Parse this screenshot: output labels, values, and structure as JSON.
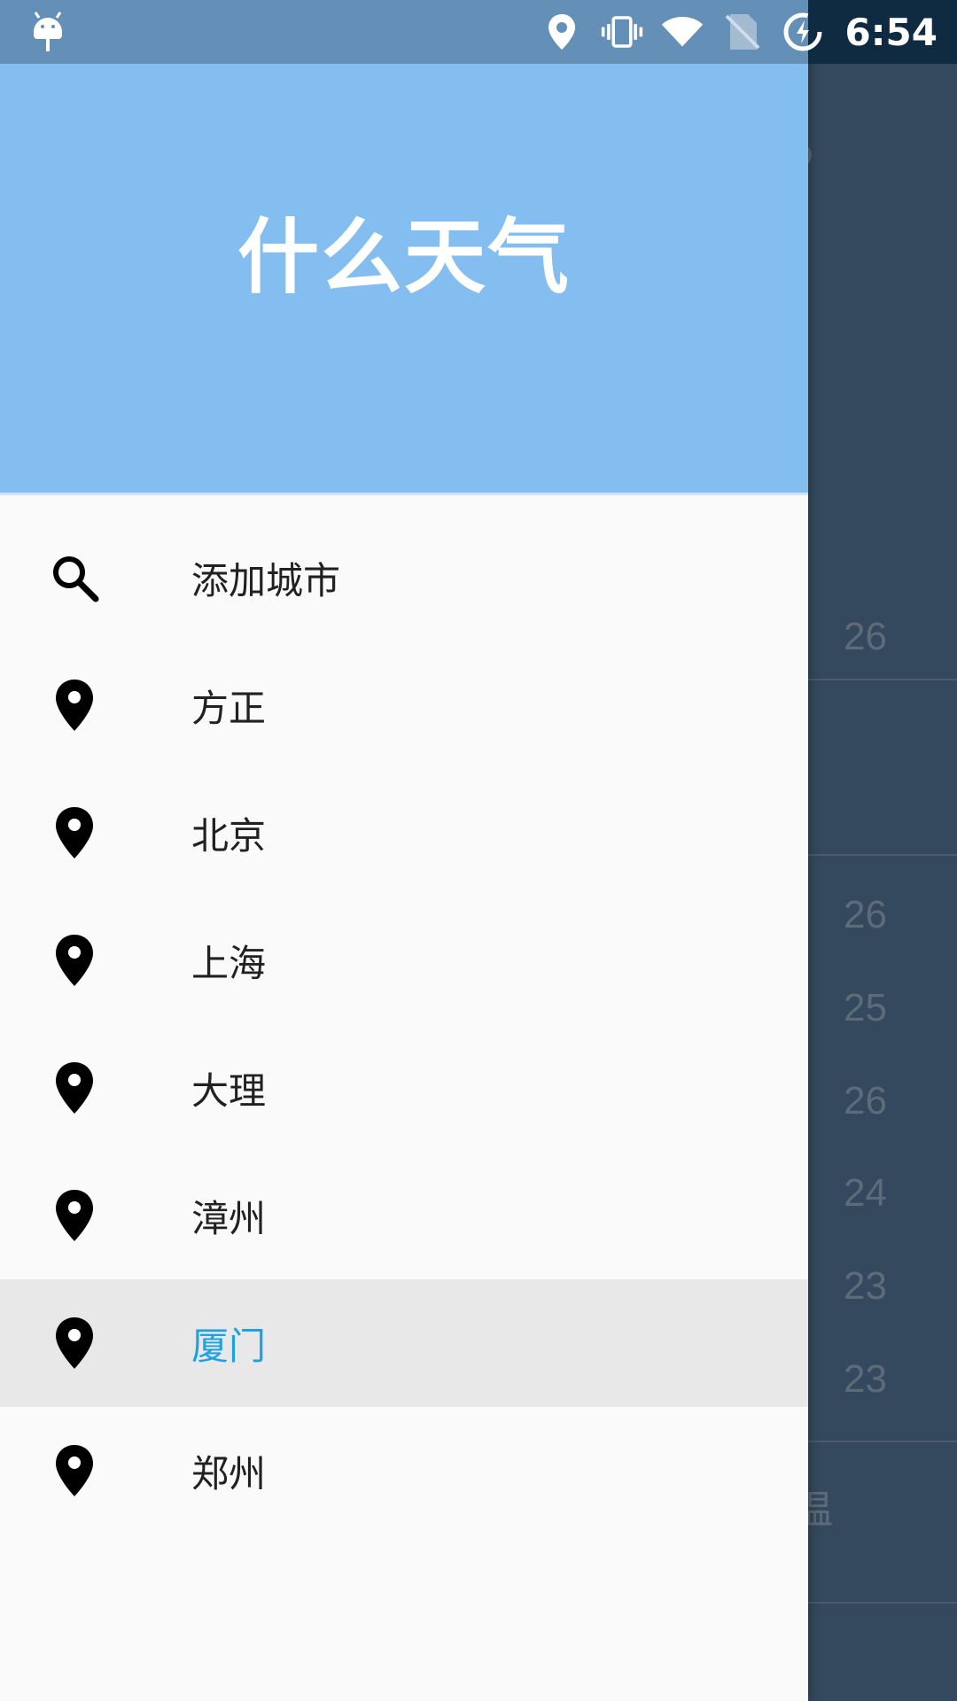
{
  "status_bar": {
    "time": "6:54",
    "icons": [
      "android-debug-icon",
      "location-icon",
      "vibrate-icon",
      "wifi-icon",
      "no-sim-icon",
      "battery-saver-icon"
    ]
  },
  "drawer": {
    "title": "什么天气",
    "header_color": "#84bef0",
    "selected_color": "#1da1e2",
    "items": [
      {
        "label": "添加城市",
        "icon": "search-icon"
      },
      {
        "label": "方正",
        "icon": "location-pin-icon"
      },
      {
        "label": "北京",
        "icon": "location-pin-icon"
      },
      {
        "label": "上海",
        "icon": "location-pin-icon"
      },
      {
        "label": "大理",
        "icon": "location-pin-icon"
      },
      {
        "label": "漳州",
        "icon": "location-pin-icon"
      },
      {
        "label": "厦门",
        "icon": "location-pin-icon",
        "selected": true
      },
      {
        "label": "郑州",
        "icon": "location-pin-icon"
      }
    ]
  },
  "background": {
    "temps": [
      "26",
      "26",
      "25",
      "26",
      "24",
      "23",
      "23"
    ],
    "partial_text": "温"
  }
}
